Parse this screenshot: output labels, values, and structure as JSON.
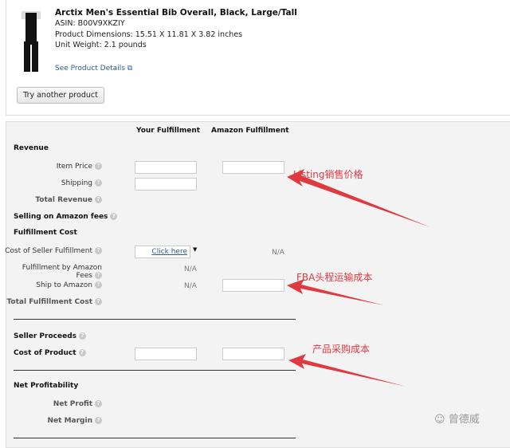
{
  "product": {
    "title": "Arctix Men's Essential Bib Overall, Black, Large/Tall",
    "asin": "ASIN: B00V9XKZIY",
    "dimensions": "Product Dimensions: 15.51 X 11.81 X 3.82 inches",
    "weight": "Unit Weight: 2.1 pounds",
    "details_link": "See Product Details",
    "external_icon": "external-link-icon",
    "try_button": "Try another product"
  },
  "columns": {
    "your": "Your Fulfillment",
    "amazon": "Amazon Fulfillment"
  },
  "rows": {
    "revenue": "Revenue",
    "item_price": "Item Price",
    "shipping": "Shipping",
    "total_revenue": "Total Revenue",
    "selling_fees": "Selling on Amazon fees",
    "fulfillment_cost": "Fulfillment Cost",
    "cost_seller": "Cost of Seller Fulfillment",
    "click_here": "Click here",
    "fba_fees_1": "Fulfillment by Amazon",
    "fba_fees_2": "Fees",
    "ship_to_amazon": "Ship to Amazon",
    "total_fulfillment": "Total Fulfillment Cost",
    "seller_proceeds": "Seller Proceeds",
    "cost_product": "Cost of Product",
    "net_profitability": "Net Profitability",
    "net_profit": "Net Profit",
    "net_margin": "Net Margin",
    "na": "N/A",
    "help": "?"
  },
  "annotations": {
    "listing": "Listing销售价格",
    "fba": "FBA头程运输成本",
    "cost": "产品采购成本",
    "color": "#e0393f"
  },
  "watermark": "曾德威"
}
